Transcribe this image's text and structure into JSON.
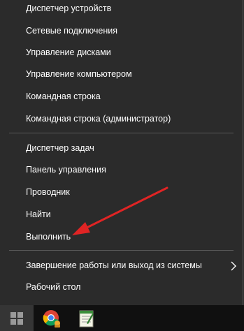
{
  "menu": {
    "items": [
      {
        "label": "Диспетчер устройств"
      },
      {
        "label": "Сетевые подключения"
      },
      {
        "label": "Управление дисками"
      },
      {
        "label": "Управление компьютером"
      },
      {
        "label": "Командная строка"
      },
      {
        "label": "Командная строка (администратор)"
      },
      {
        "label": "Диспетчер задач"
      },
      {
        "label": "Панель управления"
      },
      {
        "label": "Проводник"
      },
      {
        "label": "Найти"
      },
      {
        "label": "Выполнить"
      },
      {
        "label": "Завершение работы или выход из системы"
      },
      {
        "label": "Рабочий стол"
      }
    ]
  },
  "taskbar": {
    "icons": [
      "windows-start-icon",
      "chrome-icon",
      "notepad-icon"
    ]
  },
  "annotation": {
    "color": "#e02424"
  }
}
